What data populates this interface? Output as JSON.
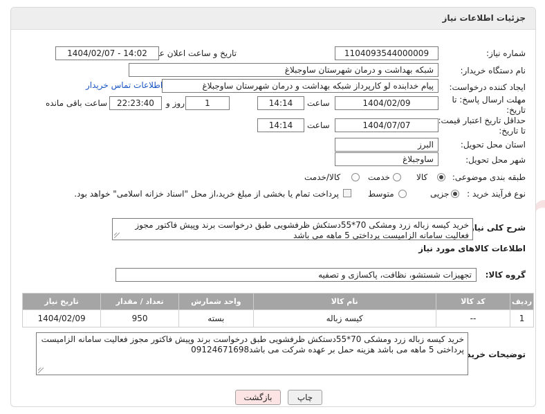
{
  "panel": {
    "title": "جزئیات اطلاعات نیاز"
  },
  "form": {
    "need_number_label": "شماره نیاز:",
    "need_number": "1104093544000009",
    "announce_label": "تاریخ و ساعت اعلان عمومی:",
    "announce_value": "1404/02/07 - 14:02",
    "buyer_org_label": "نام دستگاه خریدار:",
    "buyer_org": "شبکه بهداشت و درمان شهرستان ساوجبلاغ",
    "creator_label": "ایجاد کننده درخواست:",
    "creator": "پیام خدابنده لو کارپرداز شبکه بهداشت و درمان شهرستان ساوجبلاغ",
    "contact_link": "اطلاعات تماس خریدار",
    "deadline_label_1": "مهلت ارسال پاسخ: تا",
    "deadline_label_2": "تاریخ:",
    "deadline_date": "1404/02/09",
    "time_label": "ساعت",
    "deadline_time": "14:14",
    "days_value": "1",
    "days_label": "روز و",
    "remaining_time": "22:23:40",
    "remaining_label": "ساعت باقی مانده",
    "validity_label_1": "حداقل تاریخ اعتبار قیمت:",
    "validity_label_2": "تا تاریخ:",
    "validity_date": "1404/07/07",
    "validity_time": "14:14",
    "province_label": "استان محل تحویل:",
    "province": "البرز",
    "city_label": "شهر محل تحویل:",
    "city": "ساوجبلاغ",
    "category_label": "طبقه بندی موضوعی:",
    "category_options": [
      "کالا",
      "خدمت",
      "کالا/خدمت"
    ],
    "category_selected": "کالا",
    "process_label": "نوع فرآیند خرید :",
    "process_options": [
      "جزیی",
      "متوسط"
    ],
    "process_selected": "جزیی",
    "payment_note": "پرداخت تمام یا بخشی از مبلغ خرید،از محل \"اسناد خزانه اسلامی\" خواهد بود."
  },
  "description": {
    "label": "شرح کلی نیاز:",
    "text": "خرید کیسه زباله زرد ومشکی 70*55دستکش ظرفشویی طبق درخواست برند وپیش فاکتور مجوز فعالیت سامانه الزامیست پرداختی 5 ماهه می باشد"
  },
  "goods": {
    "section_title": "اطلاعات کالاهای مورد نیاز",
    "group_label": "گروه کالا:",
    "group_value": "تجهیزات شستشو، نظافت، پاکسازی و تصفیه",
    "columns": [
      "ردیف",
      "کد کالا",
      "نام کالا",
      "واحد شمارش",
      "تعداد / مقدار",
      "تاریخ نیاز"
    ],
    "rows": [
      [
        "1",
        "--",
        "کیسه زباله",
        "بسته",
        "950",
        "1404/02/09"
      ]
    ]
  },
  "buyer_notes": {
    "label": "توضیحات خریدار:",
    "text": "خرید کیسه زباله زرد ومشکی 70*55دستکش ظرفشویی طبق درخواست برند وپیش فاکتور مجوز فعالیت سامانه الزامیست پرداختی 5 ماهه می باشد هزینه حمل بر عهده شرکت می باشد09124671698"
  },
  "buttons": {
    "print": "چاپ",
    "back": "بازگشت"
  },
  "colors": {
    "header_bg": "#eeeeee",
    "table_header": "#a5a5a5",
    "link": "#1a55c6",
    "back_btn": "#fde4e4"
  }
}
